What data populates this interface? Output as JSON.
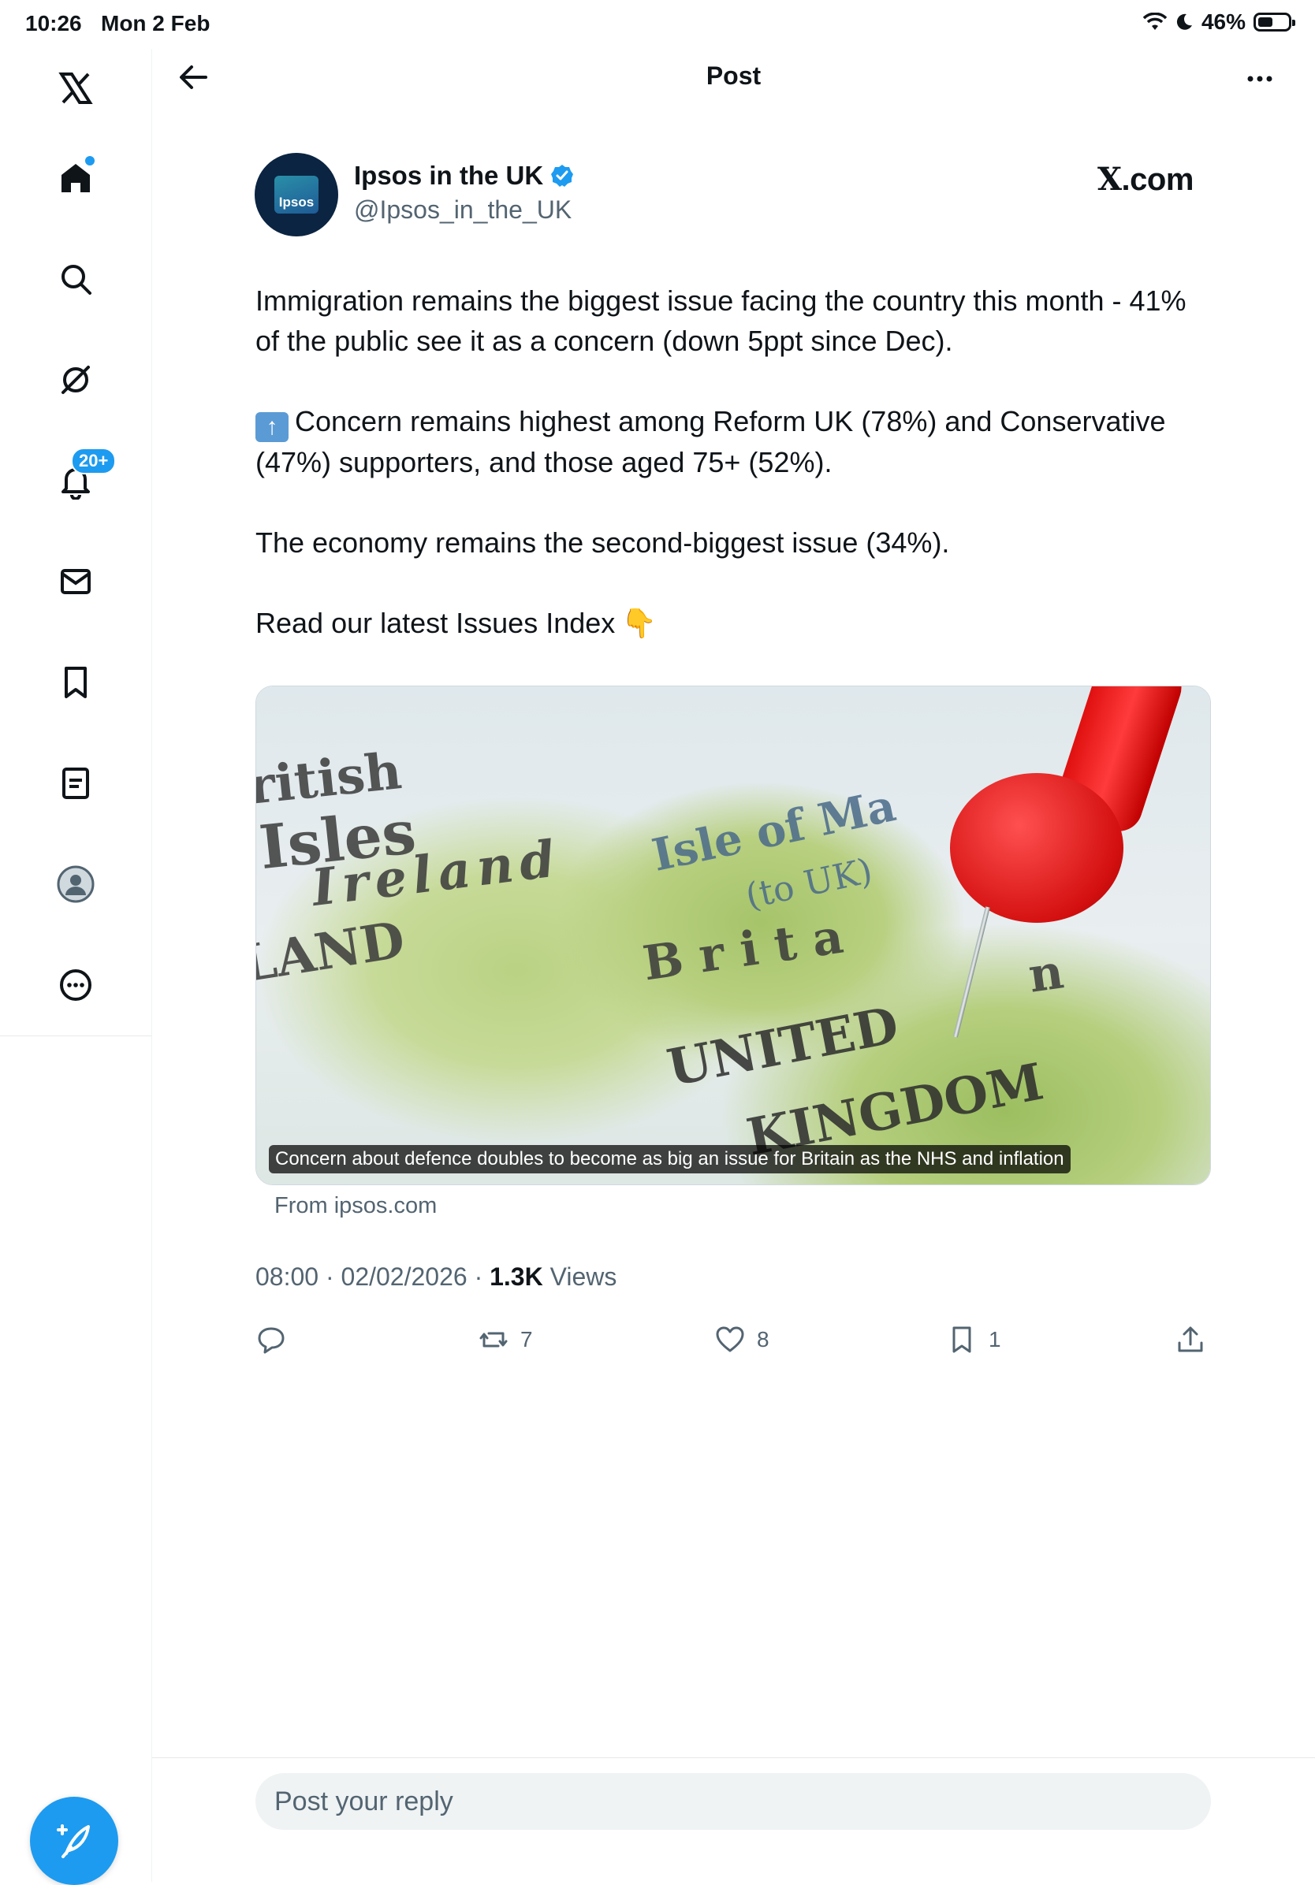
{
  "status_bar": {
    "time": "10:26",
    "date": "Mon 2 Feb",
    "battery": "46%"
  },
  "sidebar": {
    "items": [
      {
        "name": "home"
      },
      {
        "name": "explore"
      },
      {
        "name": "grok"
      },
      {
        "name": "notifications",
        "badge": "20+"
      },
      {
        "name": "messages"
      },
      {
        "name": "bookmarks"
      },
      {
        "name": "lists"
      },
      {
        "name": "profile"
      },
      {
        "name": "more"
      }
    ]
  },
  "header": {
    "title": "Post"
  },
  "post": {
    "author_name": "Ipsos in the UK",
    "author_handle": "@Ipsos_in_the_UK",
    "avatar_text": "Ipsos",
    "source_label": ".com",
    "source_glyph": "X",
    "paragraphs": [
      "Immigration remains the biggest issue facing the country this month - 41% of the public see it as a concern (down 5ppt since Dec).",
      "Concern remains highest among Reform UK (78%) and Conservative (47%) supporters, and those aged 75+ (52%).",
      "The economy remains the second-biggest issue (34%).",
      "Read our latest Issues Index"
    ],
    "card": {
      "caption": "Concern about defence doubles to become as big an issue for Britain as the NHS and inflation",
      "source": "From ipsos.com",
      "map_labels": [
        "ritish",
        "Isles",
        "Ireland",
        "Isle of Ma",
        "(to UK)",
        "LAND",
        "B r i t a",
        "n",
        "UNITED",
        "KINGDOM"
      ]
    },
    "time": "08:00",
    "date": "02/02/2026",
    "views_count": "1.3K",
    "views_label": "Views",
    "stats": {
      "replies": "",
      "reposts": "7",
      "likes": "8",
      "bookmarks": "1"
    }
  },
  "reply": {
    "placeholder": "Post your reply"
  },
  "colors": {
    "accent": "#1d9bf0",
    "text": "#0f1419",
    "muted": "#536471"
  }
}
